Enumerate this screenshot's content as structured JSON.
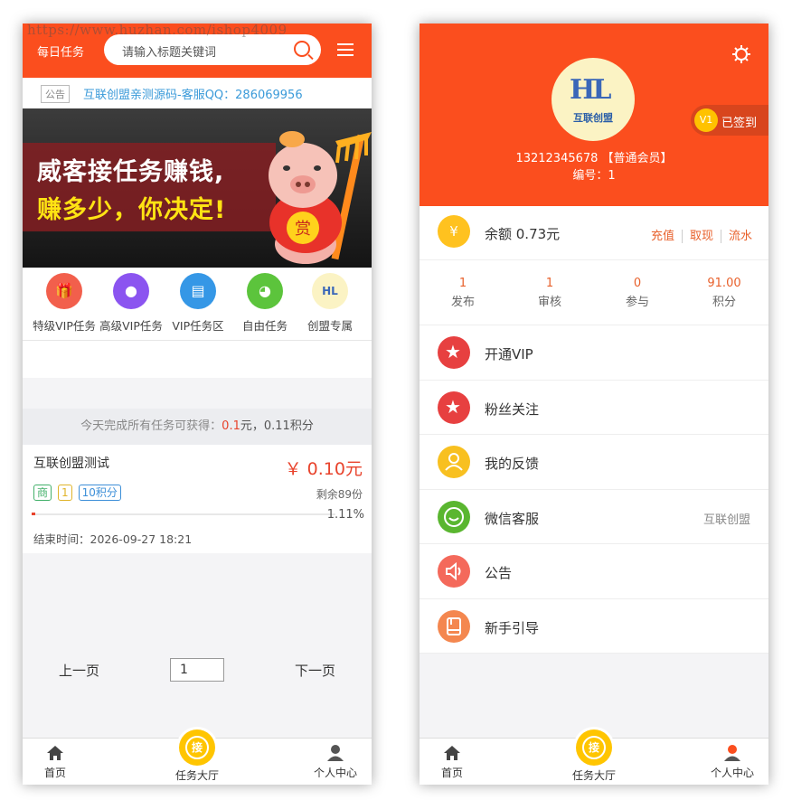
{
  "watermark": "https://www.huzhan.com/ishop4009",
  "left": {
    "header": {
      "title": "每日任务",
      "search_placeholder": "请输入标题关键词"
    },
    "notice": {
      "tag": "公告",
      "text": "互联创盟亲测源码-客服QQ：286069956"
    },
    "banner": {
      "line1": "威客接任务赚钱,",
      "line2": "赚多少，你决定!",
      "pig_badge": "赏"
    },
    "categories": [
      {
        "label": "特级VIP任务",
        "icon": "gift-icon",
        "color": "#f25f4c"
      },
      {
        "label": "高级VIP任务",
        "icon": "penguin-icon",
        "color": "#8b54f0"
      },
      {
        "label": "VIP任务区",
        "icon": "document-icon",
        "color": "#3597e6"
      },
      {
        "label": "自由任务",
        "icon": "wechat-icon",
        "color": "#5cc43c"
      },
      {
        "label": "创盟专属",
        "icon": "logo-icon",
        "color": "#fbf3c4"
      }
    ],
    "summary": {
      "prefix": "今天完成所有任务可获得：",
      "amount": "0.1",
      "unit": "元，",
      "points": "0.11积分"
    },
    "task": {
      "name": "互联创盟测试",
      "price": "￥ 0.10元",
      "badges": [
        {
          "text": "商",
          "color": "#43b06a"
        },
        {
          "text": "1",
          "color": "#e0b42a"
        },
        {
          "text": "10积分",
          "color": "#3d8fd8"
        }
      ],
      "remaining": "剩余89份",
      "progress_pct": 1.11,
      "progress_label": "1.11%",
      "end_time": "结束时间：2026-09-27 18:21"
    },
    "pager": {
      "prev": "上一页",
      "page": "1",
      "next": "下一页"
    },
    "tabbar": {
      "home": "首页",
      "hall": "任务大厅",
      "hall_badge": "接",
      "me": "个人中心"
    }
  },
  "right": {
    "profile": {
      "logo_letters": "HL",
      "logo_name": "互联创盟",
      "signed": "已签到",
      "vip": "V1",
      "phone_line": "13212345678 【普通会员】",
      "id_line": "编号：1"
    },
    "balance": {
      "icon": "¥",
      "label": "余额 0.73元",
      "actions": [
        "充值",
        "取现",
        "流水"
      ]
    },
    "stats": [
      {
        "value": "1",
        "label": "发布"
      },
      {
        "value": "1",
        "label": "审核"
      },
      {
        "value": "0",
        "label": "参与"
      },
      {
        "value": "91.00",
        "label": "积分"
      }
    ],
    "menu": [
      {
        "label": "开通VIP",
        "icon": "star-icon",
        "color": "#e74040",
        "right": ""
      },
      {
        "label": "粉丝关注",
        "icon": "star-icon",
        "color": "#e74040",
        "right": ""
      },
      {
        "label": "我的反馈",
        "icon": "people-icon",
        "color": "#f8c020",
        "right": ""
      },
      {
        "label": "微信客服",
        "icon": "chat-icon",
        "color": "#5ab630",
        "right": "互联创盟"
      },
      {
        "label": "公告",
        "icon": "speaker-icon",
        "color": "#f4695b",
        "right": ""
      },
      {
        "label": "新手引导",
        "icon": "book-icon",
        "color": "#f4874f",
        "right": ""
      }
    ],
    "tabbar": {
      "home": "首页",
      "hall": "任务大厅",
      "hall_badge": "接",
      "me": "个人中心"
    }
  }
}
